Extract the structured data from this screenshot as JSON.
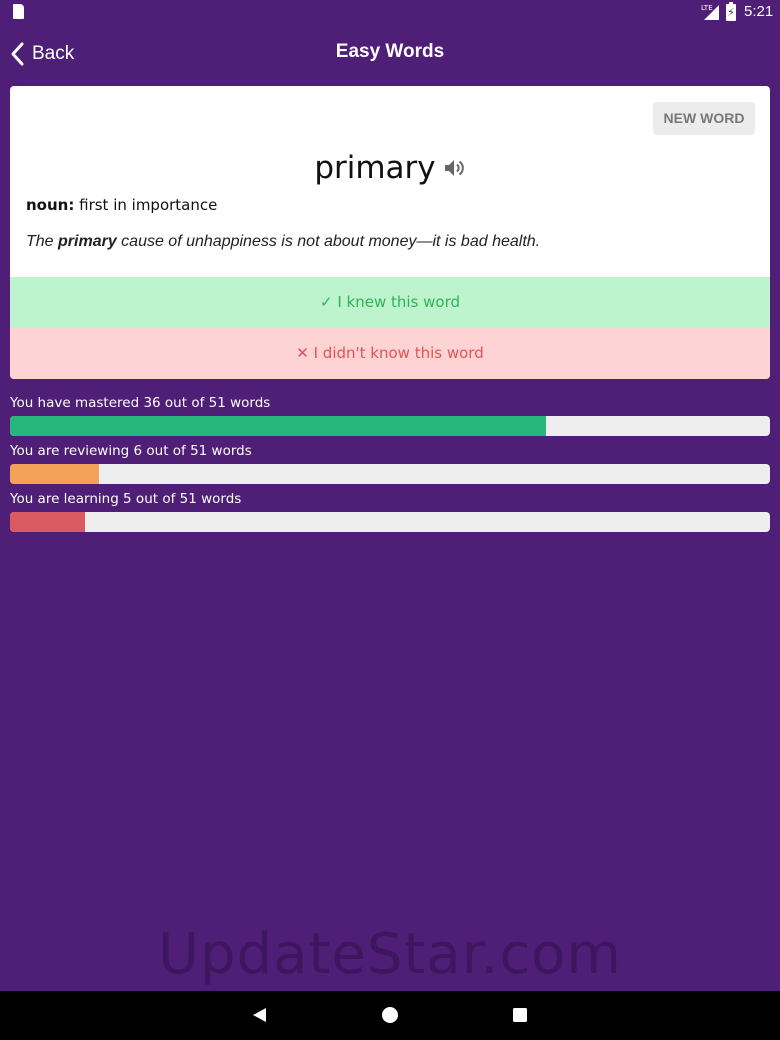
{
  "status_bar": {
    "network": "LTE",
    "time": "5:21"
  },
  "header": {
    "back_label": "Back",
    "title": "Easy Words"
  },
  "card": {
    "new_word_label": "NEW WORD",
    "word": "primary",
    "part_of_speech": "noun:",
    "definition": "first in importance",
    "example_before": "The ",
    "example_word": "primary",
    "example_after": " cause of unhappiness is not about money—it is bad health.",
    "knew_label": "✓ I knew this word",
    "didnt_know_label": "✕ I didn't know this word"
  },
  "progress": [
    {
      "label": "You have mastered 36 out of 51 words",
      "count": 36,
      "total": 51,
      "color": "#28b67c"
    },
    {
      "label": "You are reviewing 6 out of 51 words",
      "count": 6,
      "total": 51,
      "color": "#f4a259"
    },
    {
      "label": "You are learning 5 out of 51 words",
      "count": 5,
      "total": 51,
      "color": "#db5a62"
    }
  ],
  "watermark": "UpdateStar.com",
  "colors": {
    "background": "#4f1f78",
    "knew_bg": "#bdf3cd",
    "knew_text": "#2fb35a",
    "didnt_bg": "#fdd3d3",
    "didnt_text": "#e05555"
  },
  "icons": {
    "sd_card": "sd-card-icon",
    "signal": "signal-icon",
    "battery": "battery-charging-icon",
    "back": "chevron-left-icon",
    "speaker": "speaker-icon",
    "nav_back": "triangle-back-icon",
    "nav_home": "circle-home-icon",
    "nav_recents": "square-recents-icon"
  }
}
